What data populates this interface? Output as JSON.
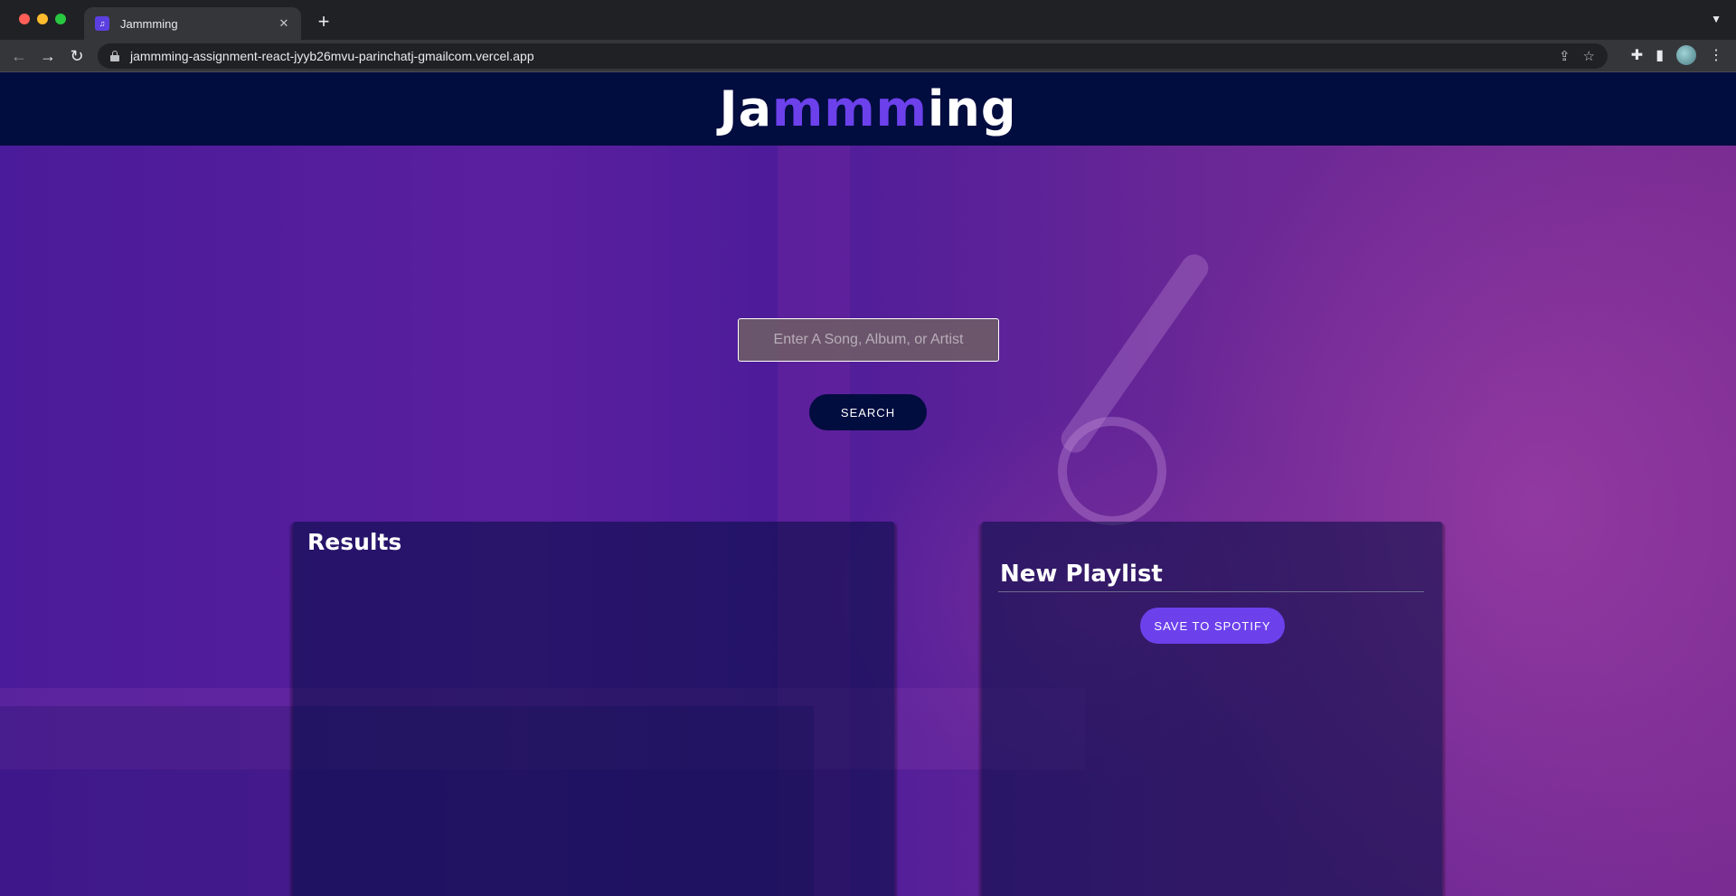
{
  "browser": {
    "tab_title": "Jammming",
    "url": "jammming-assignment-react-jyyb26mvu-parinchatj-gmailcom.vercel.app"
  },
  "app": {
    "logo_parts": [
      "Ja",
      "mmm",
      "ing"
    ],
    "accent_color": "#6c41ec",
    "header_color": "#010c3f"
  },
  "search": {
    "placeholder": "Enter A Song, Album, or Artist",
    "button_label": "SEARCH"
  },
  "results": {
    "title": "Results"
  },
  "playlist": {
    "name": "New Playlist",
    "save_label": "SAVE TO SPOTIFY"
  }
}
